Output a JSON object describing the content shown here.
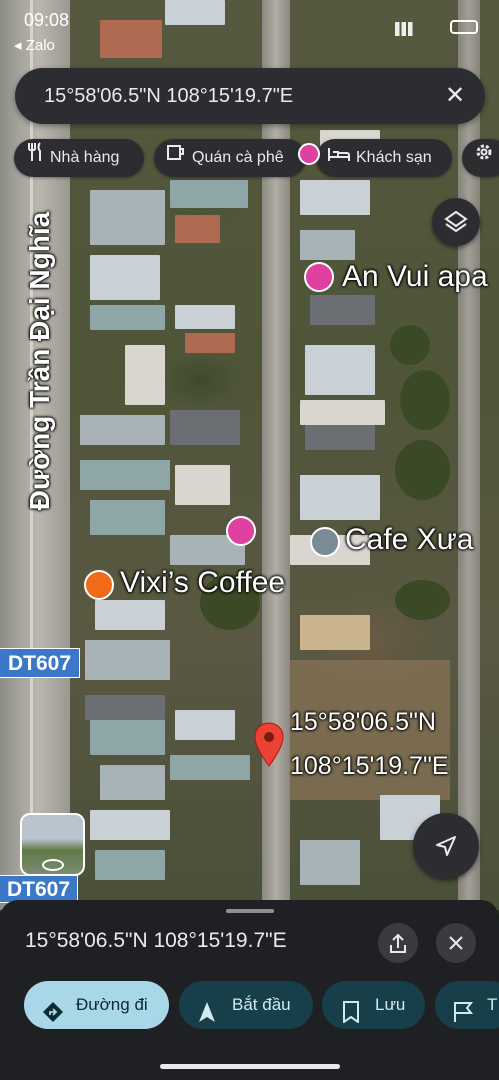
{
  "status_bar": {
    "back_app": "◂ Zalo",
    "time": "09:08"
  },
  "search": {
    "query": "15°58'06.5\"N 108°15'19.7\"E"
  },
  "chips": [
    {
      "label": "Nhà hàng",
      "icon": "fork-knife-icon"
    },
    {
      "label": "Quán cà phê",
      "icon": "coffee-cup-icon"
    },
    {
      "label": "Khách sạn",
      "icon": "bed-icon"
    }
  ],
  "map": {
    "street_label": "Đường Trần Đại Nghĩa",
    "road_badge_1": "DT607",
    "road_badge_2": "DT607",
    "places": [
      {
        "name": "An Vui apa",
        "color": "#e040a0",
        "icon": "hotel-icon"
      },
      {
        "name": "Cafe Xưa",
        "color": "#7a8a96",
        "icon": "place-icon"
      },
      {
        "name": "Vixi’s Coffee",
        "color": "#f06a1a",
        "icon": "coffee-icon"
      }
    ],
    "pin_label_line1": "15°58'06.5\"N",
    "pin_label_line2": "108°15'19.7\"E"
  },
  "sheet": {
    "coords": "15°58'06.5\"N 108°15'19.7\"E",
    "buttons": [
      {
        "label": "Đường đi",
        "primary": true
      },
      {
        "label": "Bắt đầu",
        "primary": false
      },
      {
        "label": "Lưu",
        "primary": false
      },
      {
        "label": "T",
        "primary": false
      }
    ]
  },
  "colors": {
    "accent": "#8ab4f8",
    "primary_btn": "#a8d8e8",
    "pin_red": "#ea4335"
  }
}
